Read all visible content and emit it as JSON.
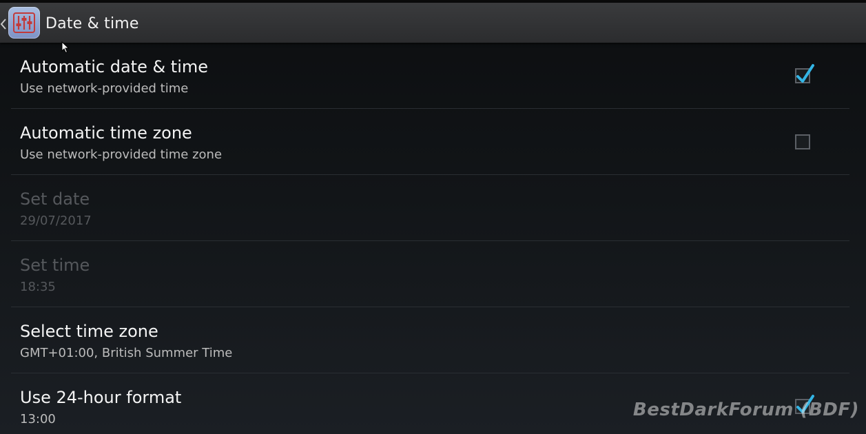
{
  "actionbar": {
    "title": "Date & time",
    "back_icon": "chevron-left-icon",
    "app_icon": "settings-sliders-icon"
  },
  "settings": [
    {
      "title": "Automatic date & time",
      "summary": "Use network-provided time",
      "enabled": true,
      "checkbox": "checked"
    },
    {
      "title": "Automatic time zone",
      "summary": "Use network-provided time zone",
      "enabled": true,
      "checkbox": "unchecked"
    },
    {
      "title": "Set date",
      "summary": "29/07/2017",
      "enabled": false
    },
    {
      "title": "Set time",
      "summary": "18:35",
      "enabled": false
    },
    {
      "title": "Select time zone",
      "summary": "GMT+01:00, British Summer Time",
      "enabled": true
    },
    {
      "title": "Use 24-hour format",
      "summary": "13:00",
      "enabled": true,
      "checkbox": "checked"
    }
  ],
  "watermark": "BestDarkForum (BDF)",
  "colors": {
    "accent": "#33b5e5",
    "actionbar": "#2f3032",
    "background": "#121518",
    "divider": "#2a2e33",
    "disabled_text": "#55585c"
  }
}
